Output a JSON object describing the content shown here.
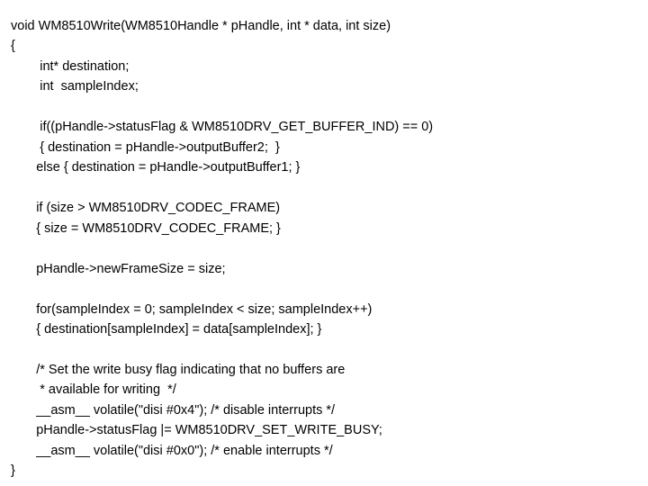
{
  "code": {
    "l01": "void WM8510Write(WM8510Handle * pHandle, int * data, int size)",
    "l02": "{",
    "l03": "        int* destination;",
    "l04": "        int  sampleIndex;",
    "l05": "",
    "l06": "        if((pHandle->statusFlag & WM8510DRV_GET_BUFFER_IND) == 0)",
    "l07": "        { destination = pHandle->outputBuffer2;  }",
    "l08": "       else { destination = pHandle->outputBuffer1; }",
    "l09": "",
    "l10": "       if (size > WM8510DRV_CODEC_FRAME)",
    "l11": "       { size = WM8510DRV_CODEC_FRAME; }",
    "l12": "",
    "l13": "       pHandle->newFrameSize = size;",
    "l14": "",
    "l15": "       for(sampleIndex = 0; sampleIndex < size; sampleIndex++)",
    "l16": "       { destination[sampleIndex] = data[sampleIndex]; }",
    "l17": "",
    "l18": "       /* Set the write busy flag indicating that no buffers are",
    "l19": "        * available for writing  */",
    "l20": "       __asm__ volatile(\"disi #0x4\"); /* disable interrupts */",
    "l21": "       pHandle->statusFlag |= WM8510DRV_SET_WRITE_BUSY;",
    "l22": "       __asm__ volatile(\"disi #0x0\"); /* enable interrupts */",
    "l23": "}"
  }
}
